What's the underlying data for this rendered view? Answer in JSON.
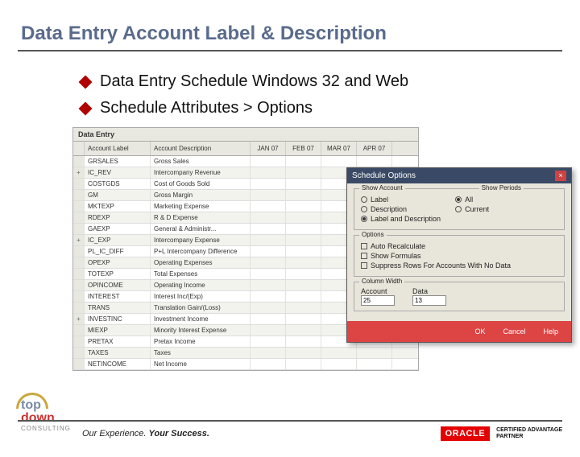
{
  "title": "Data Entry Account Label & Description",
  "bullets": [
    "Data Entry Schedule Windows 32 and Web",
    "Schedule Attributes > Options"
  ],
  "table": {
    "title": "Data Entry",
    "headers": {
      "label": "Account Label",
      "desc": "Account Description",
      "m1": "JAN 07",
      "m2": "FEB 07",
      "m3": "MAR 07",
      "m4": "APR 07"
    },
    "rows": [
      {
        "exp": "",
        "label": "GRSALES",
        "desc": "Gross Sales"
      },
      {
        "exp": "+",
        "label": "IC_REV",
        "desc": "Intercompany Revenue"
      },
      {
        "exp": "",
        "label": "COSTGDS",
        "desc": "Cost of Goods Sold"
      },
      {
        "exp": "",
        "label": "GM",
        "desc": "Gross Margin"
      },
      {
        "exp": "",
        "label": "MKTEXP",
        "desc": "Marketing Expense"
      },
      {
        "exp": "",
        "label": "RDEXP",
        "desc": "R & D Expense"
      },
      {
        "exp": "",
        "label": "GAEXP",
        "desc": "General & Administr..."
      },
      {
        "exp": "+",
        "label": "IC_EXP",
        "desc": "Intercompany Expense"
      },
      {
        "exp": "",
        "label": "PL_IC_DIFF",
        "desc": "P+L Intercompany Difference"
      },
      {
        "exp": "",
        "label": "OPEXP",
        "desc": "Operating Expenses"
      },
      {
        "exp": "",
        "label": "TOTEXP",
        "desc": "Total Expenses"
      },
      {
        "exp": "",
        "label": "OPINCOME",
        "desc": "Operating Income"
      },
      {
        "exp": "",
        "label": "INTEREST",
        "desc": "Interest Inc/(Exp)"
      },
      {
        "exp": "",
        "label": "TRANS",
        "desc": "Translation Gain/(Loss)"
      },
      {
        "exp": "+",
        "label": "INVESTINC",
        "desc": "Investment Income"
      },
      {
        "exp": "",
        "label": "MIEXP",
        "desc": "Minority Interest Expense"
      },
      {
        "exp": "",
        "label": "PRETAX",
        "desc": "Pretax Income"
      },
      {
        "exp": "",
        "label": "TAXES",
        "desc": "Taxes"
      },
      {
        "exp": "",
        "label": "NETINCOME",
        "desc": "Net Income"
      }
    ]
  },
  "dialog": {
    "title": "Schedule Options",
    "close": "×",
    "show_account": {
      "legend": "Show Account",
      "options": [
        "Label",
        "Description",
        "Label and Description"
      ],
      "selected": 2
    },
    "show_periods": {
      "legend": "Show Periods",
      "options": [
        "All",
        "Current"
      ],
      "selected": 0
    },
    "options_group": {
      "legend": "Options",
      "checks": [
        "Auto Recalculate",
        "Show Formulas",
        "Suppress Rows For Accounts With No Data"
      ]
    },
    "column_width": {
      "legend": "Column Width",
      "account_label": "Account",
      "data_label": "Data",
      "account_value": "25",
      "data_value": "13"
    },
    "buttons": {
      "ok": "OK",
      "cancel": "Cancel",
      "help": "Help"
    }
  },
  "footer": {
    "tagline_prefix": "Our Experience. ",
    "tagline_bold": "Your Success.",
    "oracle": "ORACLE",
    "cert_l1": "CERTIFIED ADVANTAGE",
    "cert_l2": "PARTNER",
    "logo_top": "top",
    "logo_down": "down",
    "logo_cons": "CONSULTING"
  }
}
